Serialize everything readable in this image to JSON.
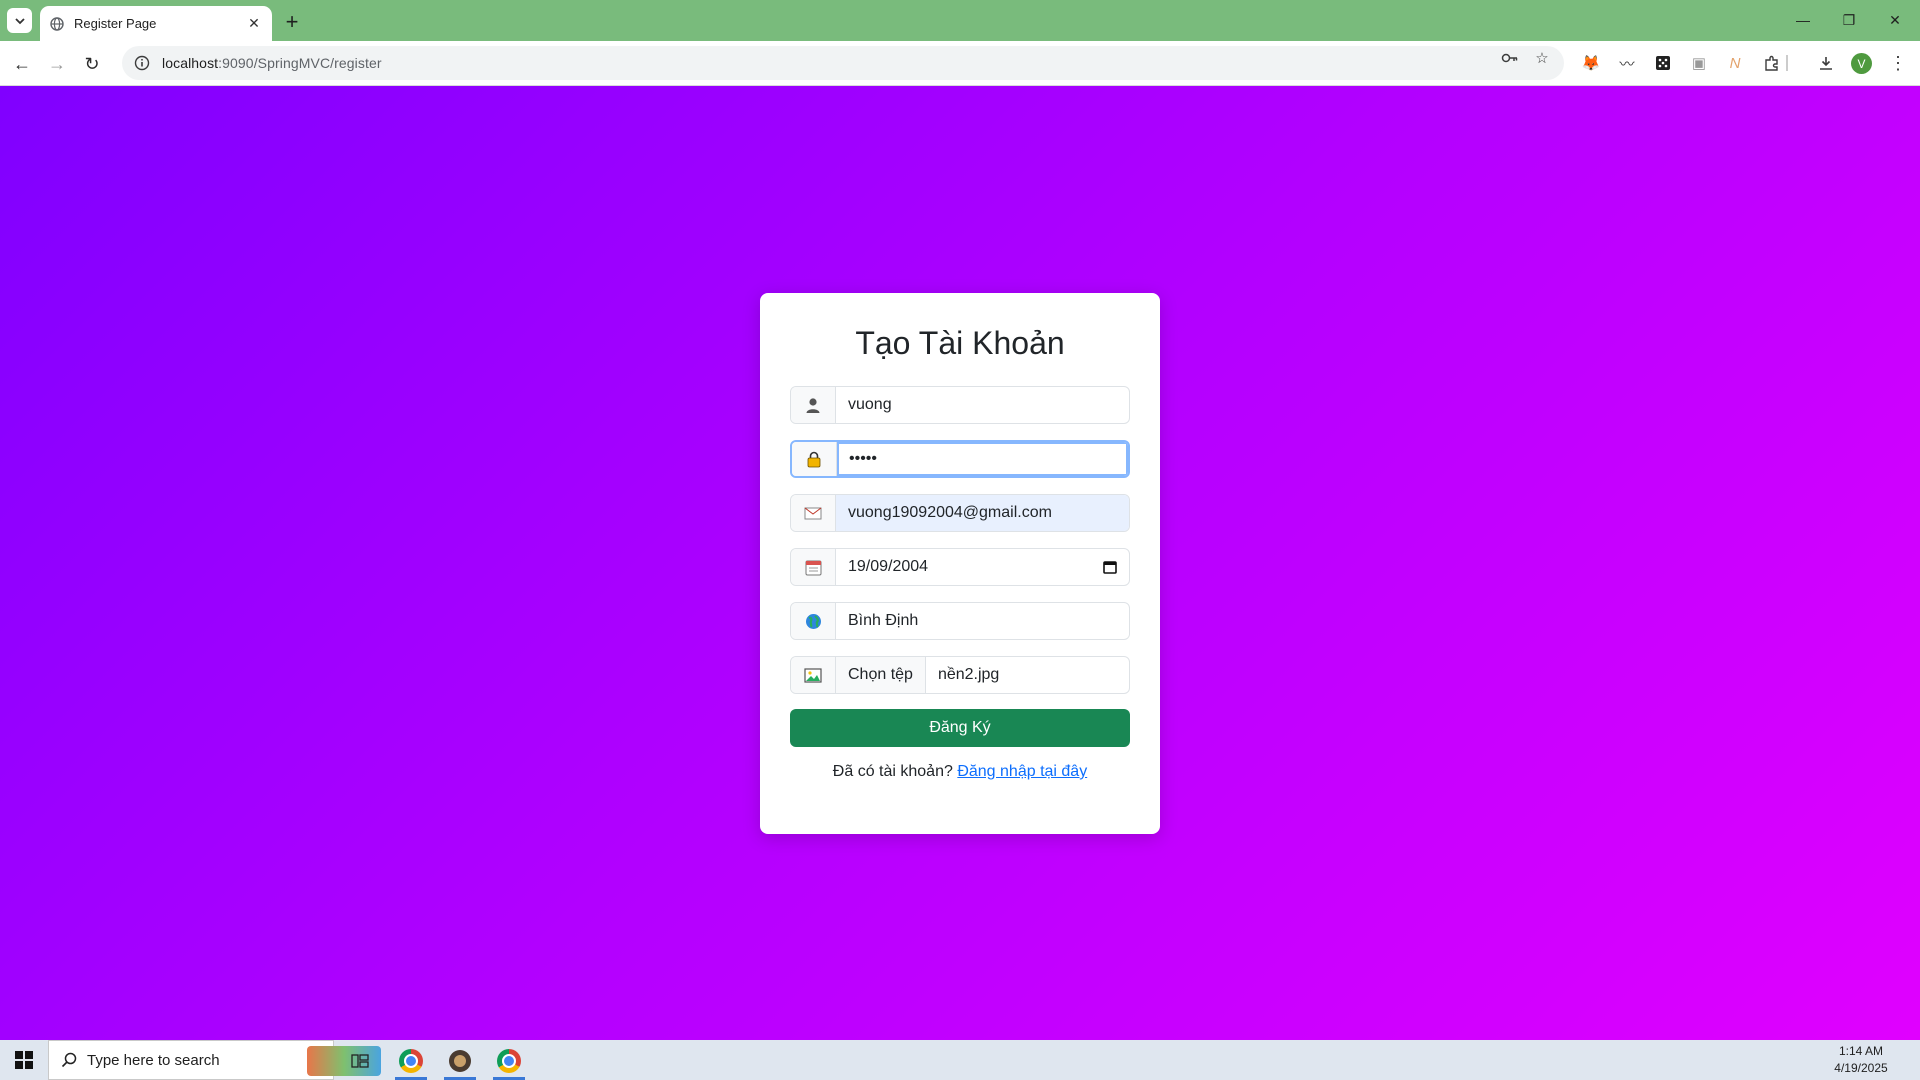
{
  "browser": {
    "tab_title": "Register Page",
    "url_host": "localhost",
    "url_rest": ":9090/SpringMVC/register",
    "profile_initial": "V"
  },
  "form": {
    "title": "Tạo Tài Khoản",
    "username": "vuong",
    "password_mask": "•••••",
    "email": "vuong19092004@gmail.com",
    "dob": "19/09/2004",
    "address": "Bình Định",
    "file_button": "Chọn tệp",
    "file_name": "nền2.jpg",
    "submit_label": "Đăng Ký",
    "login_prompt": "Đã có tài khoản?",
    "login_link": "Đăng nhập tại đây"
  },
  "taskbar": {
    "search_placeholder": "Type here to search",
    "time": "1:14 AM",
    "date": "4/19/2025"
  },
  "colors": {
    "gradient_start": "#8000ff",
    "gradient_end": "#e000ff",
    "submit": "#198754",
    "tab_strip": "#79bb7c"
  }
}
